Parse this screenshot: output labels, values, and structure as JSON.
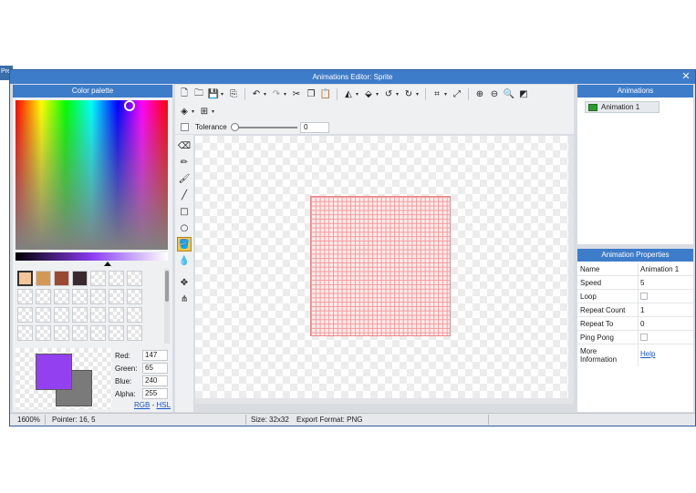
{
  "prev_tab_text": "Pre",
  "window": {
    "title": "Animations Editor: Sprite",
    "close_icon": "✕"
  },
  "color_palette": {
    "title": "Color palette",
    "swatch_colors": [
      "#f5c69a",
      "#d49a55",
      "#9a4a30",
      "#3a2a2e"
    ],
    "empty_swatch_count": 31,
    "primary_color": "#9341f0",
    "secondary_color": "#7a7a7a",
    "red_label": "Red:",
    "red_value": "147",
    "green_label": "Green:",
    "green_value": "65",
    "blue_label": "Blue:",
    "blue_value": "240",
    "alpha_label": "Alpha:",
    "alpha_value": "255",
    "rgb_link": "RGB",
    "separator": "-",
    "hsl_link": "HSL"
  },
  "toolbar": {
    "tolerance_label": "Tolerance",
    "tolerance_value": "0"
  },
  "animations": {
    "title": "Animations",
    "items": [
      "Animation 1"
    ]
  },
  "properties": {
    "title": "Animation Properties",
    "rows": {
      "name_label": "Name",
      "name_value": "Animation 1",
      "speed_label": "Speed",
      "speed_value": "5",
      "loop_label": "Loop",
      "repeat_count_label": "Repeat Count",
      "repeat_count_value": "1",
      "repeat_to_label": "Repeat To",
      "repeat_to_value": "0",
      "ping_pong_label": "Ping Pong",
      "more_info_label": "More Information",
      "help_link": "Help"
    }
  },
  "status": {
    "zoom": "1600%",
    "pointer": "Pointer: 16, 5",
    "size": "Size: 32x32",
    "export_format": "Export Format: PNG"
  }
}
